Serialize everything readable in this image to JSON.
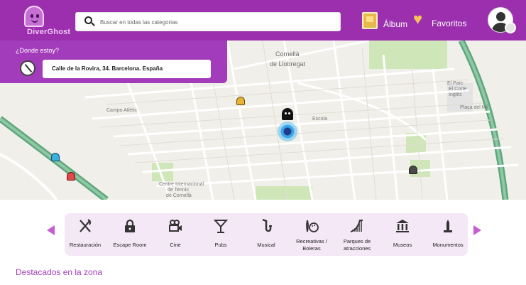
{
  "app": {
    "name": "DiverGhost"
  },
  "search": {
    "placeholder": "Buscar en todas las categorias"
  },
  "header": {
    "album_label": "Álbum",
    "favorites_label": "Favoritos"
  },
  "location": {
    "title": "¿Donde estoy?",
    "address": "Calle de la Rovira, 34. Barcelona. España"
  },
  "map": {
    "labels": [
      "Cornellà",
      "de Llobregat",
      "Centre Internacional",
      "de Tennis",
      "de Cornellà",
      "El Parc",
      "Campo Atlètic",
      "Escola",
      "El Corte",
      "Inglés",
      "Plaça del Mil"
    ]
  },
  "categories": [
    {
      "label": "Restauración",
      "icon": "fork-knife-icon"
    },
    {
      "label": "Escape Room",
      "icon": "padlock-icon"
    },
    {
      "label": "Cine",
      "icon": "video-camera-icon"
    },
    {
      "label": "Pubs",
      "icon": "cocktail-glass-icon"
    },
    {
      "label": "Musical",
      "icon": "saxophone-icon"
    },
    {
      "label": "Recreativas / Boleras",
      "icon": "bowling-icon"
    },
    {
      "label": "Parques de atracciones",
      "icon": "roller-coaster-icon"
    },
    {
      "label": "Museos",
      "icon": "museum-icon"
    },
    {
      "label": "Monumentos",
      "icon": "monument-icon"
    }
  ],
  "featured": {
    "title": "Destacados en la zona"
  },
  "colors": {
    "brand": "#9b2fae",
    "panel": "#a23cba",
    "accent_gold": "#f3c55a",
    "category_bar": "#f4e8f6"
  }
}
